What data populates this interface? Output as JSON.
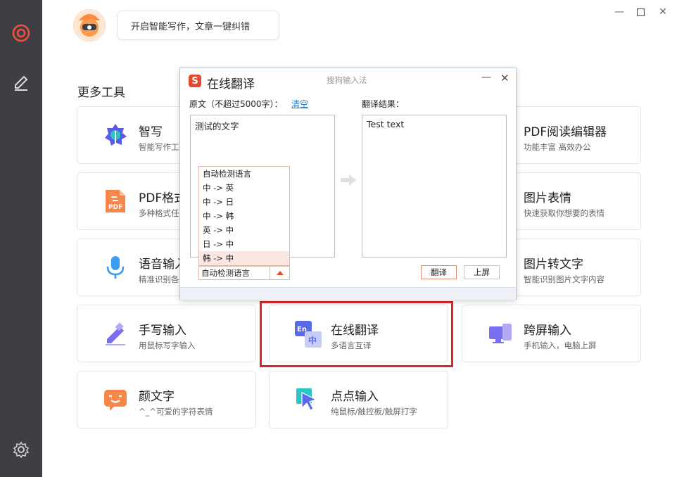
{
  "header": {
    "speech_text": "开启智能写作，文章一键纠错"
  },
  "section_title": "更多工具",
  "cards": [
    {
      "title": "智写",
      "subtitle": "智能写作工"
    },
    {
      "title": "PDF阅读编辑器",
      "subtitle": "功能丰富 高效办公"
    },
    {
      "title": "PDF格式",
      "subtitle": "多种格式任"
    },
    {
      "title": "图片表情",
      "subtitle": "快速获取你想要的表情"
    },
    {
      "title": "语音输入",
      "subtitle": "精准识别各"
    },
    {
      "title": "图片转文字",
      "subtitle": "智能识别图片文字内容"
    },
    {
      "title": "手写输入",
      "subtitle": "用鼠标写字输入"
    },
    {
      "title": "在线翻译",
      "subtitle": "多语言互译"
    },
    {
      "title": "跨屏输入",
      "subtitle": "手机输入，电脑上屏"
    },
    {
      "title": "颜文字",
      "subtitle": "^_^可爱的字符表情"
    },
    {
      "title": "点点输入",
      "subtitle": "纯鼠标/触控板/触屏打字"
    }
  ],
  "dialog": {
    "logo": "S",
    "title": "在线翻译",
    "subtitle": "搜狗输入法",
    "source_label": "原文（不超过5000字）：",
    "clear_link": "清空",
    "result_label": "翻译结果：",
    "source_text": "测试的文字",
    "result_text": "Test text",
    "lang_options": [
      "自动检测语言",
      "中 -> 英",
      "中 -> 日",
      "中 -> 韩",
      "英 -> 中",
      "日 -> 中",
      "韩 -> 中"
    ],
    "lang_selected": "自动检测语言",
    "translate_button": "翻译",
    "onscreen_button": "上屏"
  },
  "colors": {
    "sidebar": "#3d3f44",
    "accent": "#e5482d",
    "highlight": "#d9262b",
    "link": "#1a7fd3"
  }
}
